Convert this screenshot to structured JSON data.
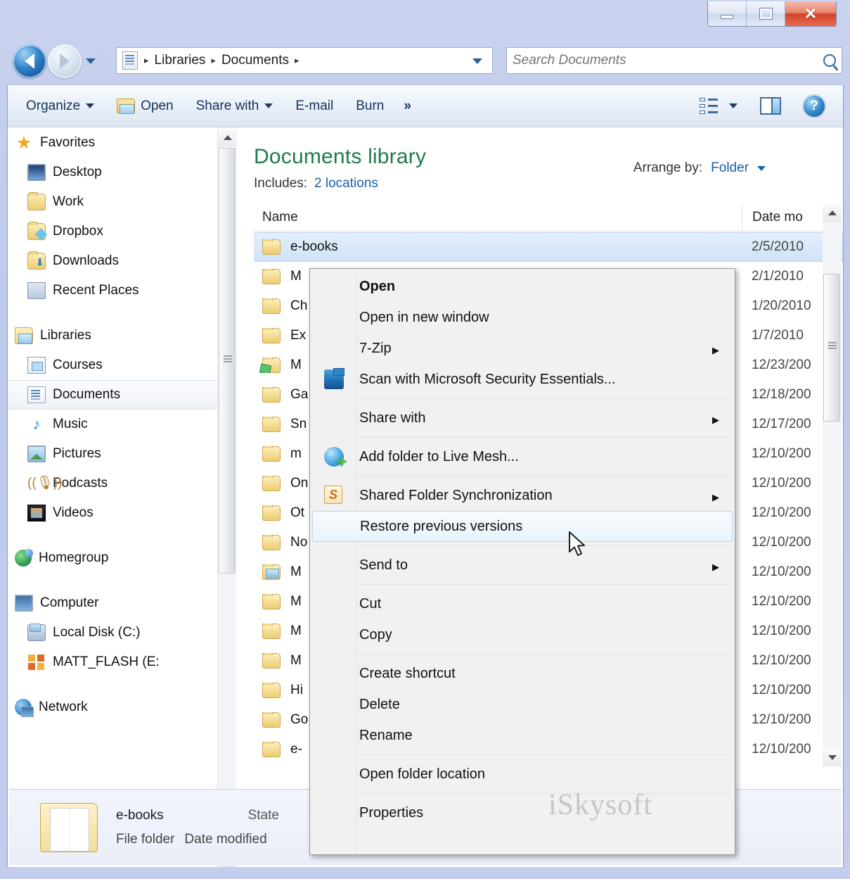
{
  "window": {
    "controls": {
      "minimize": "Minimize",
      "maximize": "Maximize",
      "close": "Close"
    }
  },
  "address": {
    "back_tooltip": "Back",
    "forward_tooltip": "Forward",
    "crumbs": [
      "Libraries",
      "Documents"
    ],
    "separator": "▸",
    "refresh": "Refresh"
  },
  "search": {
    "placeholder": "Search Documents",
    "value": ""
  },
  "toolbar": {
    "organize": "Organize",
    "open": "Open",
    "share_with": "Share with",
    "email": "E-mail",
    "burn": "Burn",
    "overflow": "»",
    "views": "Change your view",
    "preview_pane": "Show the preview pane",
    "help": "?"
  },
  "sidebar": {
    "groups": [
      {
        "root": {
          "label": "Favorites",
          "icon": "star-icon"
        },
        "items": [
          {
            "label": "Desktop",
            "icon": "desktop-icon"
          },
          {
            "label": "Work",
            "icon": "folder-icon"
          },
          {
            "label": "Dropbox",
            "icon": "dropbox-folder-icon"
          },
          {
            "label": "Downloads",
            "icon": "downloads-folder-icon"
          },
          {
            "label": "Recent Places",
            "icon": "recent-places-icon"
          }
        ]
      },
      {
        "root": {
          "label": "Libraries",
          "icon": "libraries-icon"
        },
        "items": [
          {
            "label": "Courses",
            "icon": "library-icon"
          },
          {
            "label": "Documents",
            "icon": "documents-library-icon",
            "selected": true
          },
          {
            "label": "Music",
            "icon": "music-icon"
          },
          {
            "label": "Pictures",
            "icon": "pictures-icon"
          },
          {
            "label": "Podcasts",
            "icon": "podcasts-icon"
          },
          {
            "label": "Videos",
            "icon": "videos-icon"
          }
        ]
      },
      {
        "root": {
          "label": "Homegroup",
          "icon": "homegroup-icon"
        },
        "items": []
      },
      {
        "root": {
          "label": "Computer",
          "icon": "computer-icon"
        },
        "items": [
          {
            "label": "Local Disk (C:)",
            "icon": "hard-disk-icon"
          },
          {
            "label": "MATT_FLASH (E:",
            "icon": "removable-drive-icon"
          }
        ]
      },
      {
        "root": {
          "label": "Network",
          "icon": "network-icon"
        },
        "items": []
      }
    ]
  },
  "library": {
    "title": "Documents library",
    "includes_label": "Includes:",
    "includes_value": "2 locations",
    "arrange_label": "Arrange by:",
    "arrange_value": "Folder"
  },
  "columns": {
    "name": "Name",
    "date_modified": "Date mo"
  },
  "rows": [
    {
      "name": "e-books",
      "date": "2/5/2010",
      "icon": "folder-icon",
      "selected": true
    },
    {
      "name": "M",
      "date": "2/1/2010",
      "icon": "folder-icon"
    },
    {
      "name": "Ch",
      "date": "1/20/2010",
      "icon": "folder-icon"
    },
    {
      "name": "Ex",
      "date": "1/7/2010",
      "icon": "folder-icon"
    },
    {
      "name": "M",
      "date": "12/23/200",
      "icon": "folder-gem-icon"
    },
    {
      "name": "Ga",
      "date": "12/18/200",
      "icon": "folder-icon"
    },
    {
      "name": "Sn",
      "date": "12/17/200",
      "icon": "folder-icon"
    },
    {
      "name": "m",
      "date": "12/10/200",
      "icon": "folder-icon"
    },
    {
      "name": "On",
      "date": "12/10/200",
      "icon": "folder-icon"
    },
    {
      "name": "Ot",
      "date": "12/10/200",
      "icon": "folder-icon"
    },
    {
      "name": "No",
      "date": "12/10/200",
      "icon": "folder-icon"
    },
    {
      "name": "M",
      "date": "12/10/200",
      "icon": "folder-picture-icon"
    },
    {
      "name": "M",
      "date": "12/10/200",
      "icon": "folder-icon"
    },
    {
      "name": "M",
      "date": "12/10/200",
      "icon": "folder-icon"
    },
    {
      "name": "M",
      "date": "12/10/200",
      "icon": "folder-icon"
    },
    {
      "name": "Hi",
      "date": "12/10/200",
      "icon": "folder-icon"
    },
    {
      "name": "Go",
      "date": "12/10/200",
      "icon": "folder-icon"
    },
    {
      "name": "e-",
      "date": "12/10/200",
      "icon": "folder-icon"
    }
  ],
  "context_menu": {
    "items": [
      {
        "label": "Open",
        "bold": true,
        "icon": null,
        "submenu": false,
        "separator_after": false
      },
      {
        "label": "Open in new window",
        "bold": false,
        "icon": null,
        "submenu": false,
        "separator_after": false
      },
      {
        "label": "7-Zip",
        "bold": false,
        "icon": null,
        "submenu": true,
        "separator_after": false
      },
      {
        "label": "Scan with Microsoft Security Essentials...",
        "bold": false,
        "icon": "security-essentials-icon",
        "submenu": false,
        "separator_after": true
      },
      {
        "label": "Share with",
        "bold": false,
        "icon": null,
        "submenu": true,
        "separator_after": true
      },
      {
        "label": "Add folder to Live Mesh...",
        "bold": false,
        "icon": "live-mesh-icon",
        "submenu": false,
        "separator_after": true
      },
      {
        "label": "Shared Folder Synchronization",
        "bold": false,
        "icon": "shared-folder-sync-icon",
        "submenu": true,
        "separator_after": false
      },
      {
        "label": "Restore previous versions",
        "bold": false,
        "icon": null,
        "submenu": false,
        "highlighted": true,
        "separator_after": true
      },
      {
        "label": "Send to",
        "bold": false,
        "icon": null,
        "submenu": true,
        "separator_after": true
      },
      {
        "label": "Cut",
        "bold": false,
        "icon": null,
        "submenu": false,
        "separator_after": false
      },
      {
        "label": "Copy",
        "bold": false,
        "icon": null,
        "submenu": false,
        "separator_after": true
      },
      {
        "label": "Create shortcut",
        "bold": false,
        "icon": null,
        "submenu": false,
        "separator_after": false
      },
      {
        "label": "Delete",
        "bold": false,
        "icon": null,
        "submenu": false,
        "separator_after": false
      },
      {
        "label": "Rename",
        "bold": false,
        "icon": null,
        "submenu": false,
        "separator_after": true
      },
      {
        "label": "Open folder location",
        "bold": false,
        "icon": null,
        "submenu": false,
        "separator_after": true
      },
      {
        "label": "Properties",
        "bold": false,
        "icon": null,
        "submenu": false,
        "separator_after": false
      }
    ],
    "submenu_glyph": "▶"
  },
  "details_pane": {
    "name": "e-books",
    "state_label": "State",
    "type": "File folder",
    "date_modified_label": "Date modified"
  },
  "watermark": "iSkysoft",
  "colors": {
    "library_title": "#1e7a4d",
    "link": "#1b5fa8",
    "selection": "#cfe3f8",
    "menu_bg": "#f1f1f1",
    "highlight_border": "#b8d6ef",
    "close_button": "#cf442c"
  }
}
